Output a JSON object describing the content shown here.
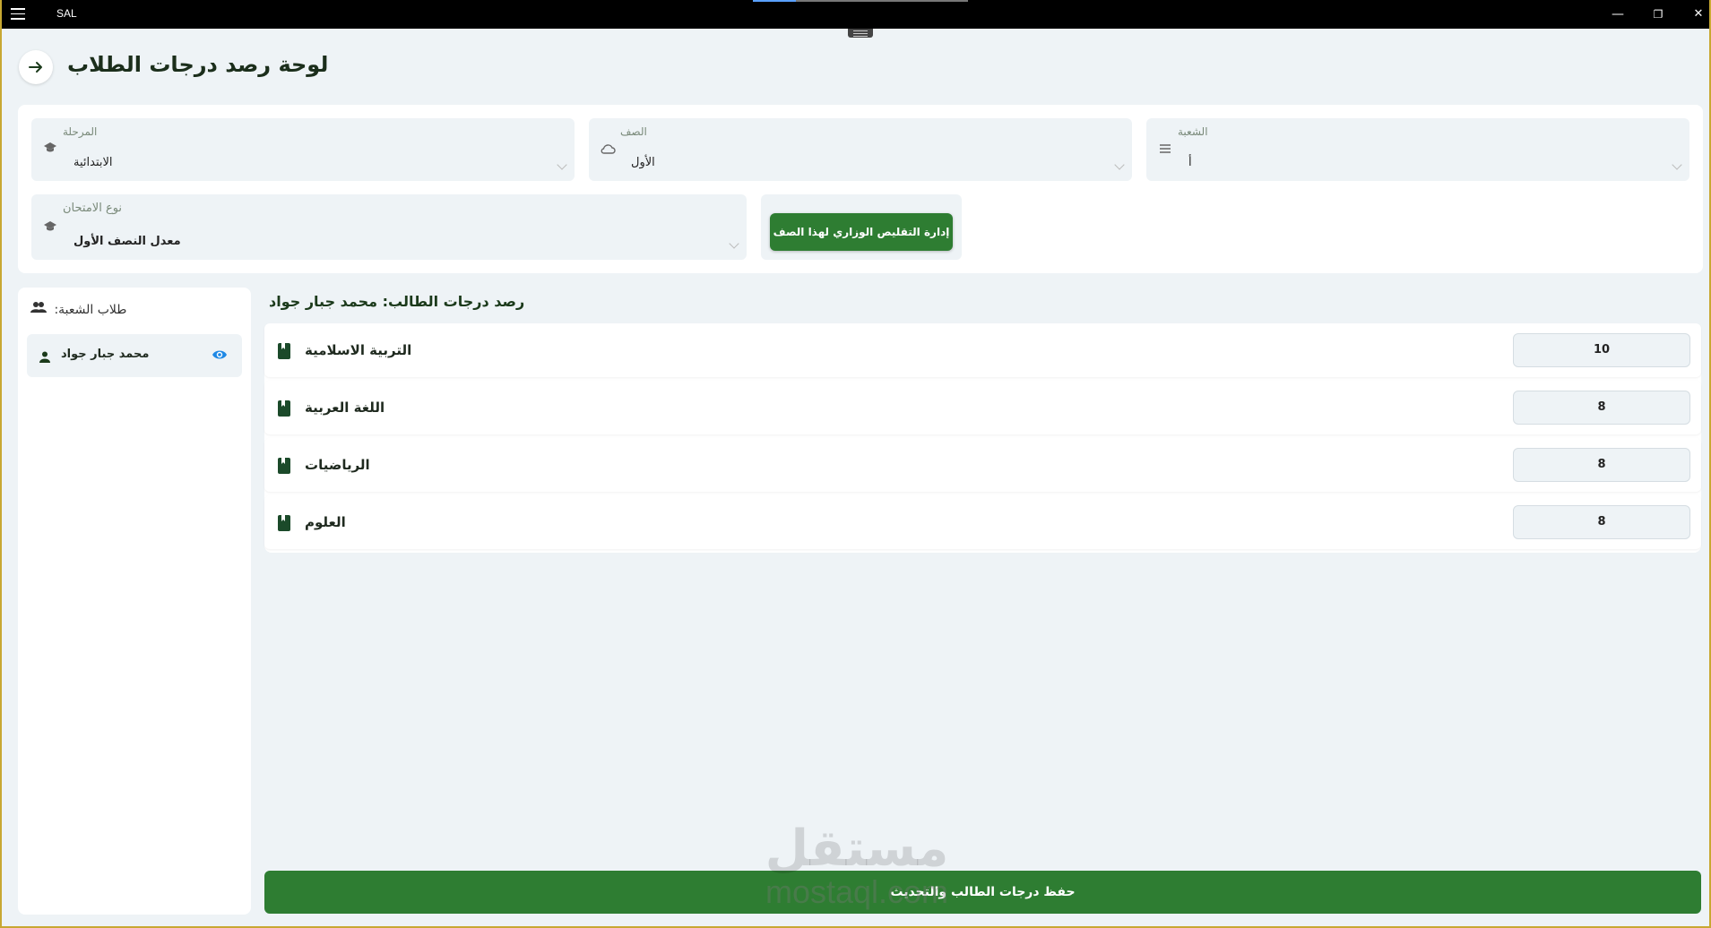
{
  "window": {
    "app_name": "SAL",
    "controls": {
      "minimize": "—",
      "restore": "❐",
      "close": "✕"
    }
  },
  "header": {
    "title": "لوحة رصد درجات الطلاب"
  },
  "filters": {
    "stage": {
      "label": "المرحلة",
      "value": "الابتدائية",
      "icon": "graduation-cap-icon"
    },
    "grade": {
      "label": "الصف",
      "value": "الأول",
      "icon": "cloud-icon"
    },
    "section": {
      "label": "الشعبة",
      "value": "أ",
      "icon": "list-icon"
    },
    "exam_type": {
      "label": "نوع الامتحان",
      "value": "معدل النصف الأول",
      "icon": "graduation-cap-icon"
    },
    "ministry_button": "إدارة التقليص الوزاري لهذا الصف"
  },
  "students": {
    "title": "طلاب الشعبة:",
    "items": [
      {
        "name": "محمد جبار جواد"
      }
    ]
  },
  "grades": {
    "title": "رصد درجات الطالب: محمد جبار جواد",
    "subjects": [
      {
        "name": "التربية الاسلامية",
        "grade": "10"
      },
      {
        "name": "اللغة العربية",
        "grade": "8"
      },
      {
        "name": "الرياضيات",
        "grade": "8"
      },
      {
        "name": "العلوم",
        "grade": "8"
      }
    ]
  },
  "save_button": "حفظ درجات الطالب والتحديث",
  "watermark": {
    "arabic": "مستقل",
    "latin": "mostaql.com"
  },
  "colors": {
    "primary": "#2e7d32",
    "background": "#eef3f6",
    "eye": "#1e88e5"
  }
}
